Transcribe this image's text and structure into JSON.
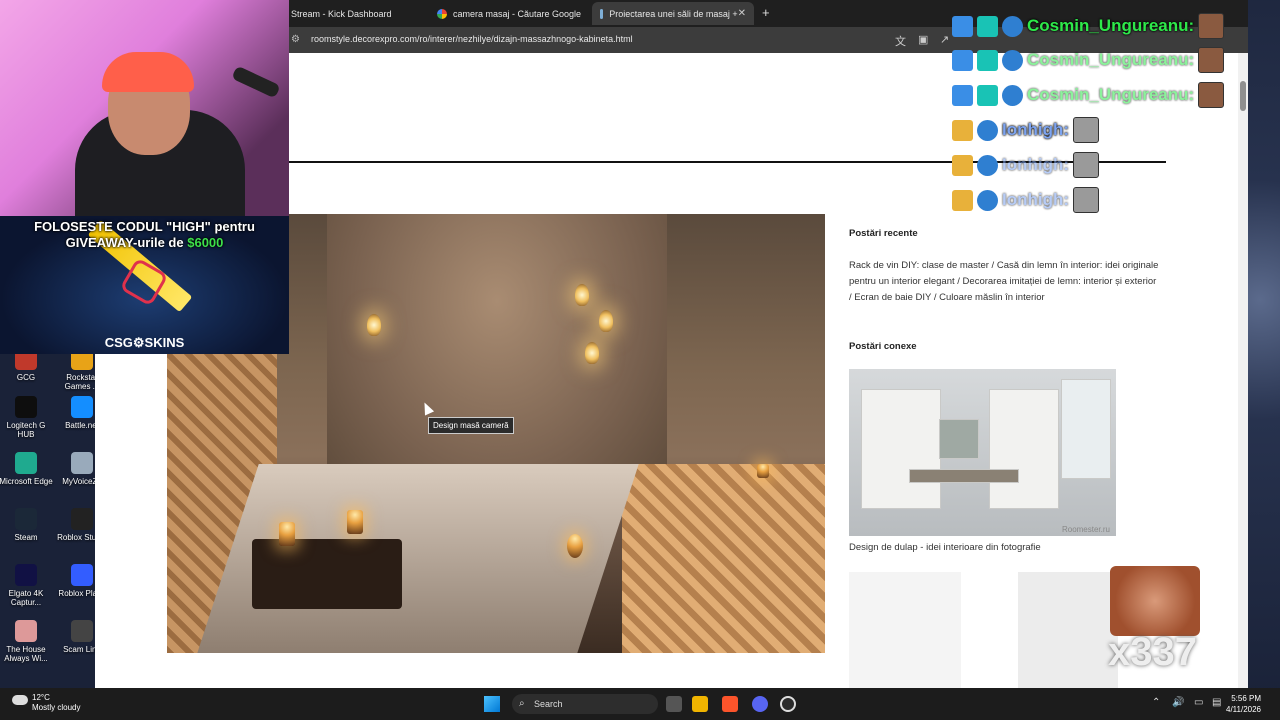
{
  "desktop_icons": [
    {
      "label": "GCG",
      "color": "#c0392b"
    },
    {
      "label": "Rockstar Games ...",
      "color": "#e8a317"
    },
    {
      "label": "Logitech G HUB",
      "color": "#0e0e0e"
    },
    {
      "label": "Battle.net",
      "color": "#148eff"
    },
    {
      "label": "Microsoft Edge",
      "color": "#1faa8f"
    },
    {
      "label": "MyVoiceZo",
      "color": "#9ab"
    },
    {
      "label": "Steam",
      "color": "#1b2838"
    },
    {
      "label": "Roblox Studio",
      "color": "#222"
    },
    {
      "label": "Elgato 4K Captur...",
      "color": "#114"
    },
    {
      "label": "Roblox Playe",
      "color": "#335dff"
    },
    {
      "label": "The House Always Wi...",
      "color": "#d99"
    },
    {
      "label": "Scam Line",
      "color": "#444"
    }
  ],
  "browser": {
    "tabs": [
      {
        "label": "Stream - Kick Dashboard",
        "active": false
      },
      {
        "label": "camera masaj - Căutare Google",
        "active": false
      },
      {
        "label": "Proiectarea unei săli de masaj +",
        "active": true
      }
    ],
    "url": "roomstyle.decorexpro.com/ro/interer/nezhilye/dizajn-massazhnogo-kabineta.html"
  },
  "page": {
    "tooltip": "Design masă cameră",
    "sidebar": {
      "recent_title": "Postări recente",
      "recent_text": "Rack de vin DIY: clase de master / Casă din lemn în interior: idei originale pentru un interior elegant / Decorarea imitației de lemn: interior și exterior / Ecran de baie DIY / Culoare măslin în interior",
      "related_title": "Postări conexe",
      "related1_caption": "Design de dulap - idei interioare din fotografie",
      "watermark": "Roomester.ru"
    }
  },
  "overlay": {
    "promo_line1": "FOLOSESTE CODUL \"HIGH\" pentru",
    "promo_line2": "GIVEAWAY-urile de",
    "promo_amount": "$6000",
    "promo_brand": "CSG⚙SKINS",
    "chat": [
      {
        "user": "Cosmin_Ungureanu:",
        "color": "#2ee84a"
      },
      {
        "user": "Cosmin_Ungureanu:",
        "color": "#2ee84a"
      },
      {
        "user": "Cosmin_Ungureanu:",
        "color": "#2ee84a"
      },
      {
        "user": "Ionhigh:",
        "color": "#7da4f0"
      },
      {
        "user": "Ionhigh:",
        "color": "#7da4f0"
      },
      {
        "user": "Ionhigh:",
        "color": "#7da4f0"
      }
    ],
    "emote_count": "x337"
  },
  "taskbar": {
    "temp": "12°C",
    "weather": "Mostly cloudy",
    "search": "Search",
    "time": "5:56 PM",
    "date": "4/11/2026"
  }
}
